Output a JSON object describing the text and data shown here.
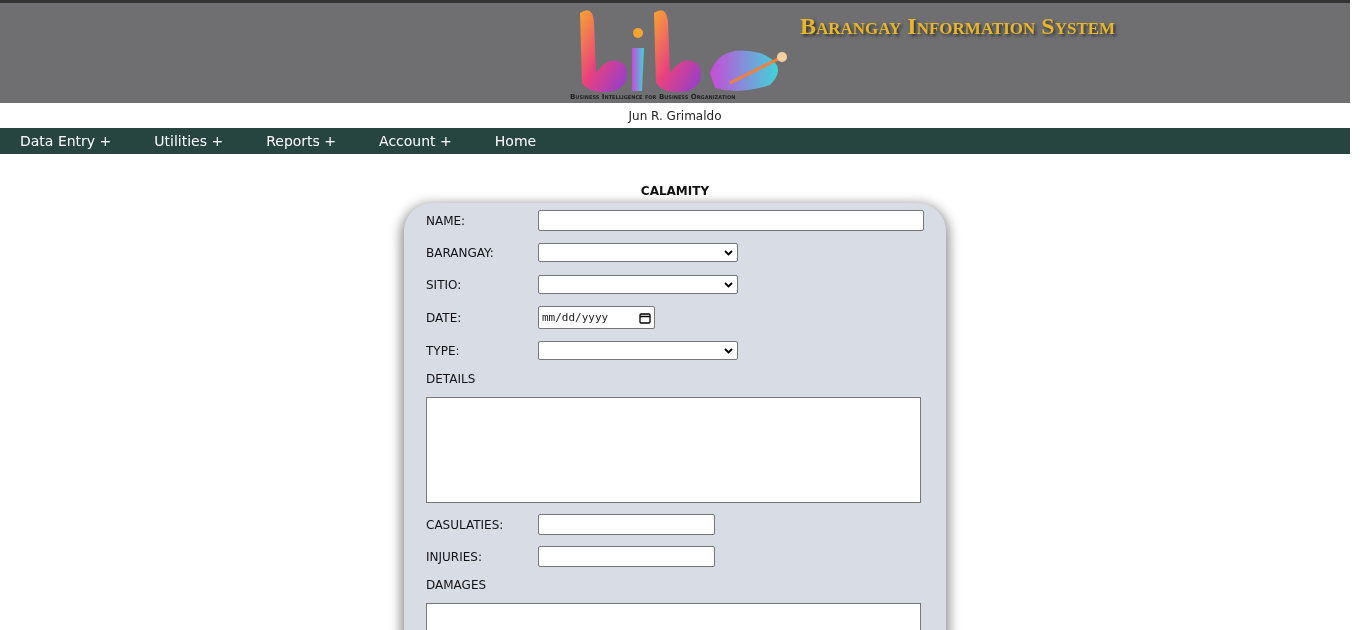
{
  "header": {
    "title": "Barangay Information System",
    "tagline": "Business Intelligence for Business Organization"
  },
  "user": {
    "name": "Jun R. Grimaldo"
  },
  "menu": [
    {
      "label": "Data Entry +"
    },
    {
      "label": "Utilities +"
    },
    {
      "label": "Reports +"
    },
    {
      "label": "Account +"
    },
    {
      "label": "Home"
    }
  ],
  "form": {
    "title": "CALAMITY",
    "fields": [
      {
        "label": "NAME:",
        "kind": "text"
      },
      {
        "label": "BARANGAY:",
        "kind": "select"
      },
      {
        "label": "SITIO:",
        "kind": "select"
      },
      {
        "label": "DATE:",
        "kind": "date",
        "placeholder": "mm/dd/yyyy"
      },
      {
        "label": "TYPE:",
        "kind": "select"
      },
      {
        "label": "DETAILS",
        "kind": "textarea"
      },
      {
        "label": "CASULATIES:",
        "kind": "short"
      },
      {
        "label": "INJURIES:",
        "kind": "short"
      },
      {
        "label": "DAMAGES",
        "kind": "textarea"
      }
    ]
  }
}
